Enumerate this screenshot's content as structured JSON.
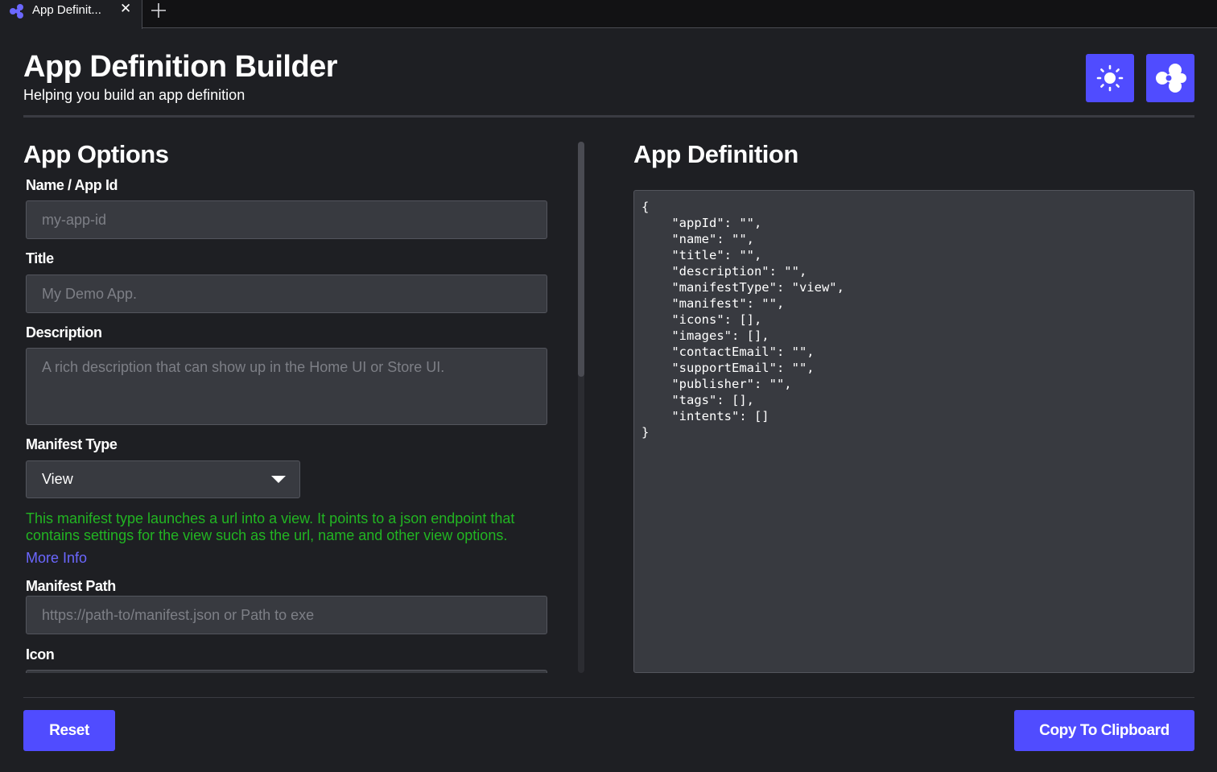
{
  "tab": {
    "title": "App Definit...",
    "close_glyph": "✕",
    "icon": "app-logo-icon",
    "new_tab_icon": "plus-icon"
  },
  "header": {
    "title": "App Definition Builder",
    "subtitle": "Helping you build an app definition",
    "theme_icon": "sun-icon",
    "logo_icon": "app-logo-icon"
  },
  "options": {
    "title": "App Options",
    "name_label": "Name / App Id",
    "name_placeholder": "my-app-id",
    "title_label": "Title",
    "title_placeholder": "My Demo App.",
    "description_label": "Description",
    "description_placeholder": "A rich description that can show up in the Home UI or Store UI.",
    "manifest_type_label": "Manifest Type",
    "manifest_type_value": "View",
    "manifest_help": "This manifest type launches a url into a view. It points to a json endpoint that contains settings for the view such as the url, name and other view options.",
    "more_info": "More Info",
    "manifest_path_label": "Manifest Path",
    "manifest_path_placeholder": "https://path-to/manifest.json or Path to exe",
    "icon_label": "Icon"
  },
  "definition": {
    "title": "App Definition",
    "json_text": "{\n    \"appId\": \"\",\n    \"name\": \"\",\n    \"title\": \"\",\n    \"description\": \"\",\n    \"manifestType\": \"view\",\n    \"manifest\": \"\",\n    \"icons\": [],\n    \"images\": [],\n    \"contactEmail\": \"\",\n    \"supportEmail\": \"\",\n    \"publisher\": \"\",\n    \"tags\": [],\n    \"intents\": []\n}"
  },
  "footer": {
    "reset_label": "Reset",
    "copy_label": "Copy To Clipboard"
  },
  "colors": {
    "background": "#1e1f23",
    "accent": "#504cff",
    "input_bg": "#383a40",
    "help_text": "#22b522",
    "link": "#6b67ff"
  }
}
